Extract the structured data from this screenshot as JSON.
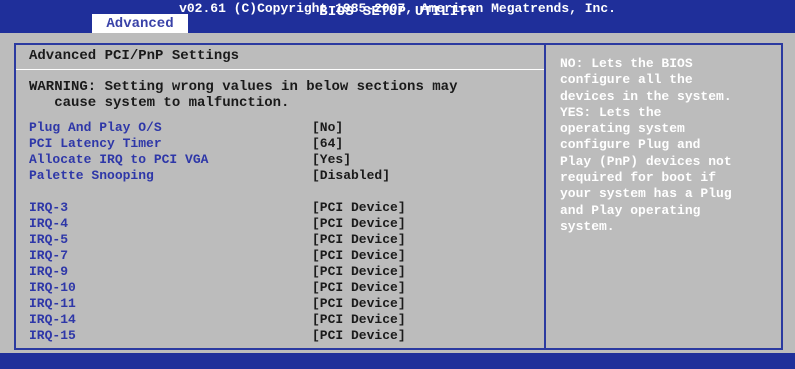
{
  "header": {
    "title": "BIOS SETUP UTILITY",
    "active_tab": "Advanced"
  },
  "panel": {
    "heading": "Advanced PCI/PnP Settings",
    "warning": [
      "WARNING: Setting wrong values in below sections may",
      "   cause system to malfunction."
    ],
    "settings": [
      {
        "label": "Plug And Play O/S",
        "value": "[No]"
      },
      {
        "label": "PCI Latency Timer",
        "value": "[64]"
      },
      {
        "label": "Allocate IRQ to PCI VGA",
        "value": "[Yes]"
      },
      {
        "label": "Palette Snooping",
        "value": "[Disabled]"
      }
    ],
    "irqs": [
      {
        "label": "IRQ-3",
        "value": "[PCI Device]"
      },
      {
        "label": "IRQ-4",
        "value": "[PCI Device]"
      },
      {
        "label": "IRQ-5",
        "value": "[PCI Device]"
      },
      {
        "label": "IRQ-7",
        "value": "[PCI Device]"
      },
      {
        "label": "IRQ-9",
        "value": "[PCI Device]"
      },
      {
        "label": "IRQ-10",
        "value": "[PCI Device]"
      },
      {
        "label": "IRQ-11",
        "value": "[PCI Device]"
      },
      {
        "label": "IRQ-14",
        "value": "[PCI Device]"
      },
      {
        "label": "IRQ-15",
        "value": "[PCI Device]"
      }
    ]
  },
  "help": {
    "lines": [
      "NO: Lets the BIOS",
      "configure all the",
      "devices in the system.",
      "YES: Lets the",
      "operating system",
      "configure Plug and",
      "Play (PnP) devices not",
      "required for boot if",
      "your system has a Plug",
      "and Play operating",
      "system."
    ]
  },
  "footer": {
    "text": "v02.61 (C)Copyright 1985-2007, American Megatrends, Inc."
  },
  "colors": {
    "bar": "#1f2f9a",
    "panel": "#bcbcbc",
    "label": "#2e37a8",
    "text": "#1a1a1a",
    "help_text": "#ffffff"
  }
}
